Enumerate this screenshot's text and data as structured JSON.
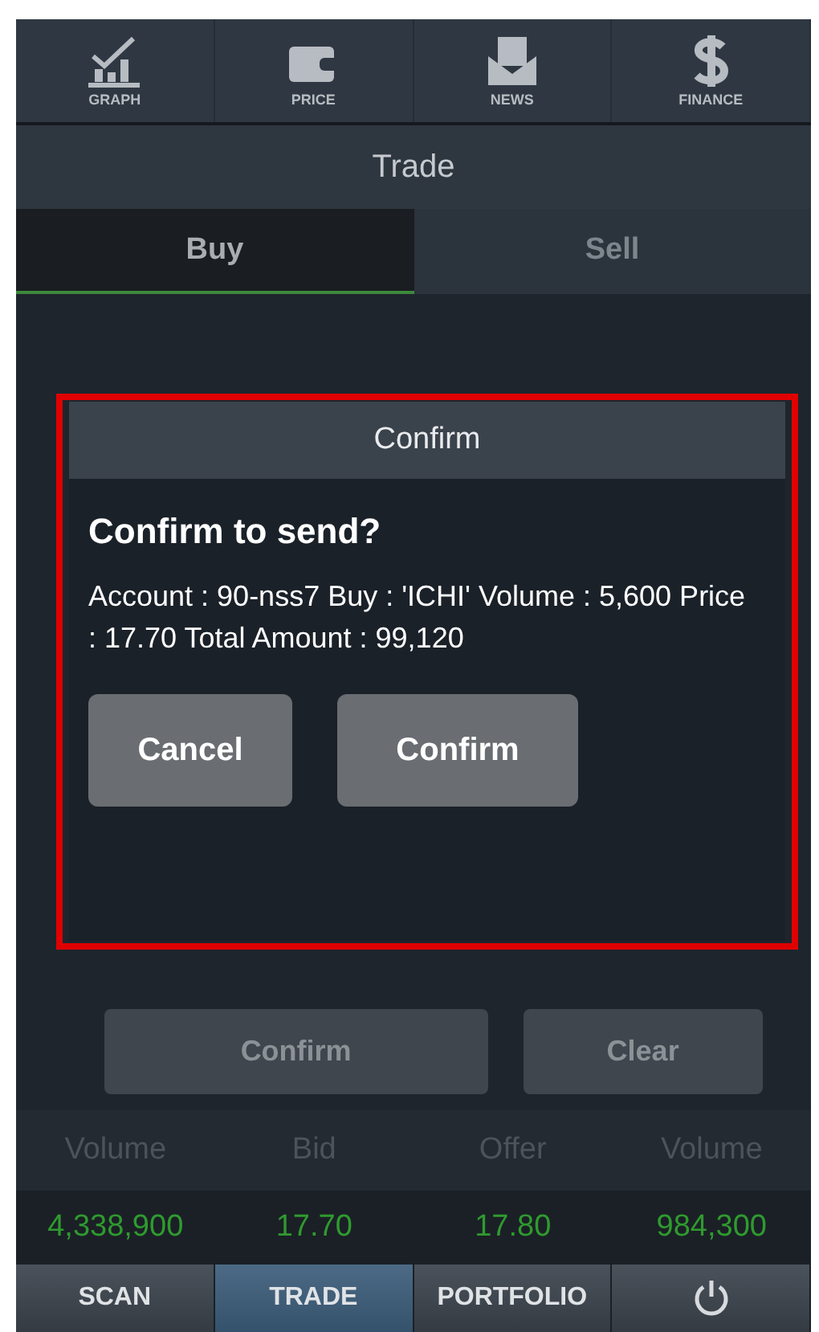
{
  "top_menu": [
    {
      "kind": "graph",
      "label": "GRAPH"
    },
    {
      "kind": "price",
      "label": "PRICE"
    },
    {
      "kind": "news",
      "label": "NEWS"
    },
    {
      "kind": "finance",
      "label": "FINANCE"
    }
  ],
  "title": "Trade",
  "tabs": [
    {
      "label": "Buy",
      "selected": true
    },
    {
      "label": "Sell",
      "selected": false
    }
  ],
  "dialog": {
    "title": "Confirm",
    "heading": "Confirm to send?",
    "message": "Account : 90-nss7 Buy : 'ICHI' Volume : 5,600 Price : 17.70 Total Amount : 99,120",
    "buttons": [
      "Cancel",
      "Confirm"
    ]
  },
  "actions": [
    "Confirm",
    "Clear"
  ],
  "quote": {
    "columns": [
      "Volume",
      "Bid",
      "Offer",
      "Volume"
    ],
    "values": [
      "4,338,900",
      "17.70",
      "17.80",
      "984,300"
    ]
  },
  "bottom_nav": [
    {
      "kind": "text",
      "label": "SCAN",
      "selected": false
    },
    {
      "kind": "text",
      "label": "TRADE",
      "selected": true
    },
    {
      "kind": "text",
      "label": "PORTFOLIO",
      "selected": false
    },
    {
      "kind": "power",
      "selected": false
    }
  ]
}
